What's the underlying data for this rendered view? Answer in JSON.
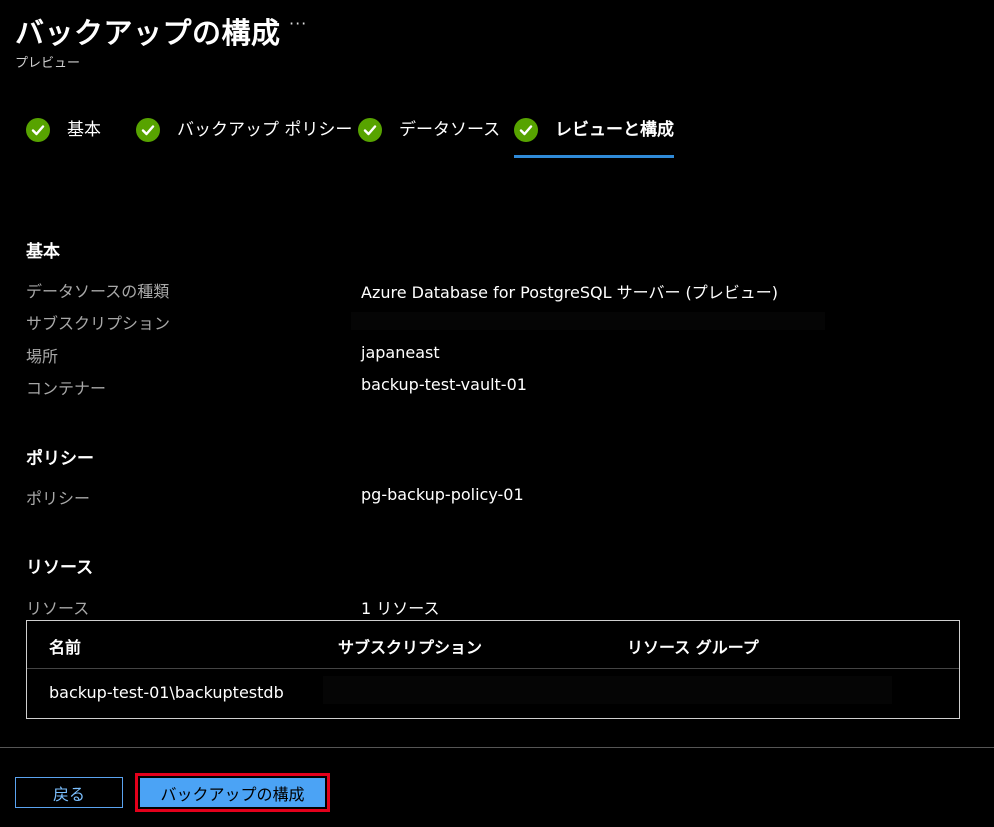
{
  "header": {
    "title": "バックアップの構成",
    "more": "···",
    "subtitle": "プレビュー"
  },
  "tabs": [
    {
      "label": "基本",
      "status": "complete"
    },
    {
      "label": "バックアップ ポリシー",
      "status": "complete"
    },
    {
      "label": "データソース",
      "status": "complete"
    },
    {
      "label": "レビューと構成",
      "status": "complete",
      "active": true
    }
  ],
  "basics": {
    "section_title": "基本",
    "rows": [
      {
        "label": "データソースの種類",
        "value": "Azure Database for PostgreSQL サーバー (プレビュー)"
      },
      {
        "label": "サブスクリプション",
        "value": ""
      },
      {
        "label": "場所",
        "value": "japaneast"
      },
      {
        "label": "コンテナー",
        "value": "backup-test-vault-01"
      }
    ]
  },
  "policy": {
    "section_title": "ポリシー",
    "label": "ポリシー",
    "value": "pg-backup-policy-01"
  },
  "resources": {
    "section_title": "リソース",
    "label": "リソース",
    "value": "1 リソース",
    "columns": [
      "名前",
      "サブスクリプション",
      "リソース グループ"
    ],
    "rows": [
      {
        "name": "backup-test-01\\backuptestdb",
        "subscription": "",
        "resource_group": ""
      }
    ]
  },
  "footer": {
    "back_label": "戻る",
    "configure_label": "バックアップの構成"
  },
  "colors": {
    "check": "#57a300",
    "active_tab_underline": "#2f8ad8",
    "primary_button": "#4ba3f5",
    "highlight_border": "#e3001b"
  }
}
